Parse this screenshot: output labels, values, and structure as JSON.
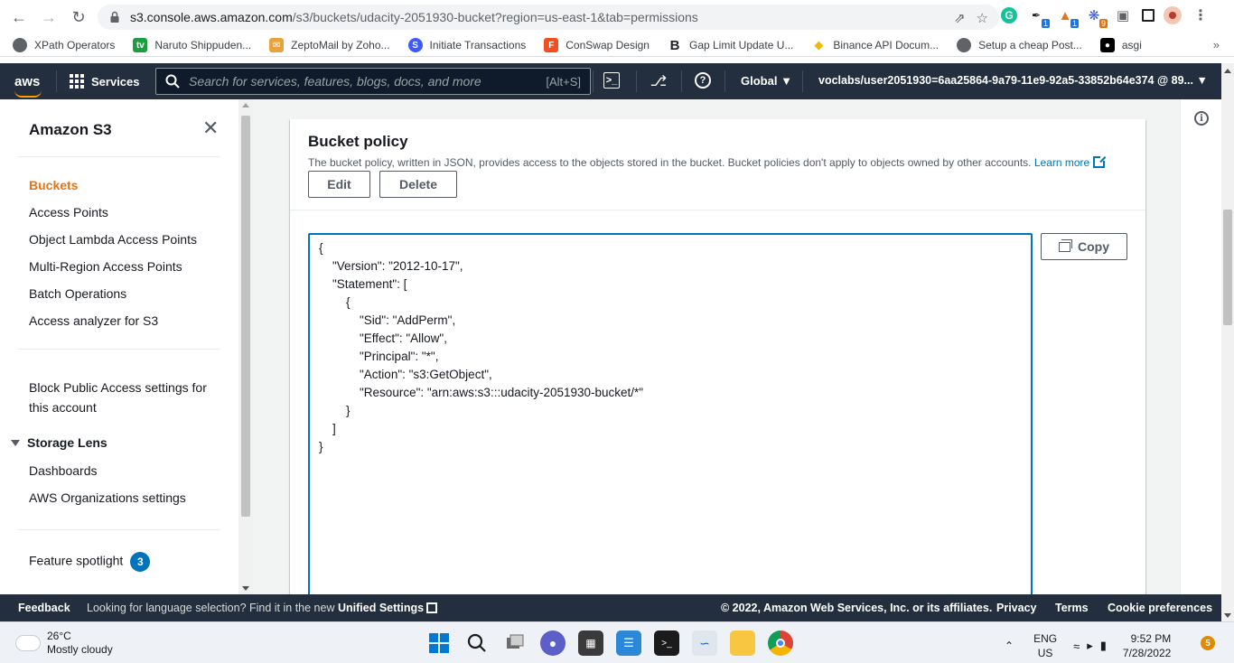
{
  "browser": {
    "url_domain": "s3.console.aws.amazon.com",
    "url_path": "/s3/buckets/udacity-2051930-bucket?region=us-east-1&tab=permissions",
    "extension_badge_blue": "1",
    "extension_badge_orange": "9",
    "bookmarks": [
      {
        "label": "XPath Operators",
        "icon": "globe-icon",
        "color": "#5f6368"
      },
      {
        "label": "Naruto Shippuden...",
        "icon": "tv-icon",
        "color": "#1a9e3f"
      },
      {
        "label": "ZeptoMail by Zoho...",
        "icon": "mail-icon",
        "color": "#e8a33d"
      },
      {
        "label": "Initiate Transactions",
        "icon": "s-logo-icon",
        "color": "#3d5afe"
      },
      {
        "label": "ConSwap Design",
        "icon": "figma-icon",
        "color": "#f24e1e"
      },
      {
        "label": "Gap Limit Update U...",
        "icon": "b-logo-icon",
        "color": "#202124"
      },
      {
        "label": "Binance API Docum...",
        "icon": "binance-icon",
        "color": "#f0b90b"
      },
      {
        "label": "Setup a cheap Post...",
        "icon": "globe-icon",
        "color": "#5f6368"
      },
      {
        "label": "asgi",
        "icon": "medium-icon",
        "color": "#000000"
      }
    ]
  },
  "aws_nav": {
    "logo": "aws",
    "services_label": "Services",
    "search_placeholder": "Search for services, features, blogs, docs, and more",
    "search_shortcut": "[Alt+S]",
    "region_label": "Global",
    "account_label": "voclabs/user2051930=6aa25864-9a79-11e9-92a5-33852b64e374 @ 89..."
  },
  "sidebar": {
    "title": "Amazon S3",
    "items": [
      {
        "label": "Buckets",
        "active": true
      },
      {
        "label": "Access Points"
      },
      {
        "label": "Object Lambda Access Points"
      },
      {
        "label": "Multi-Region Access Points"
      },
      {
        "label": "Batch Operations"
      },
      {
        "label": "Access analyzer for S3"
      }
    ],
    "block_public_line1": "Block Public Access settings for",
    "block_public_line2": "this account",
    "storage_lens_label": "Storage Lens",
    "storage_lens_items": [
      "Dashboards",
      "AWS Organizations settings"
    ],
    "feature_spotlight_label": "Feature spotlight",
    "feature_spotlight_count": "3"
  },
  "bucket_policy": {
    "title": "Bucket policy",
    "description": "The bucket policy, written in JSON, provides access to the objects stored in the bucket. Bucket policies don't apply to objects owned by other accounts.",
    "learn_more": "Learn more",
    "edit_label": "Edit",
    "delete_label": "Delete",
    "copy_label": "Copy",
    "code_lines": [
      "{",
      "    \"Version\": \"2012-10-17\",",
      "    \"Statement\": [",
      "        {",
      "            \"Sid\": \"AddPerm\",",
      "            \"Effect\": \"Allow\",",
      "            \"Principal\": \"*\",",
      "            \"Action\": \"s3:GetObject\",",
      "            \"Resource\": \"arn:aws:s3:::udacity-2051930-bucket/*\"",
      "        }",
      "    ]",
      "}"
    ]
  },
  "footer": {
    "feedback": "Feedback",
    "language_prompt": "Looking for language selection? Find it in the new",
    "unified_settings": "Unified Settings",
    "copyright": "© 2022, Amazon Web Services, Inc. or its affiliates.",
    "privacy": "Privacy",
    "terms": "Terms",
    "cookie_preferences": "Cookie preferences"
  },
  "taskbar": {
    "temperature": "26°C",
    "weather": "Mostly cloudy",
    "lang_line1": "ENG",
    "lang_line2": "US",
    "time": "9:52 PM",
    "date": "7/28/2022",
    "notification_count": "5"
  },
  "colors": {
    "aws_nav_bg": "#232f3e",
    "aws_orange": "#ec7211",
    "aws_link_blue": "#0073bb"
  }
}
